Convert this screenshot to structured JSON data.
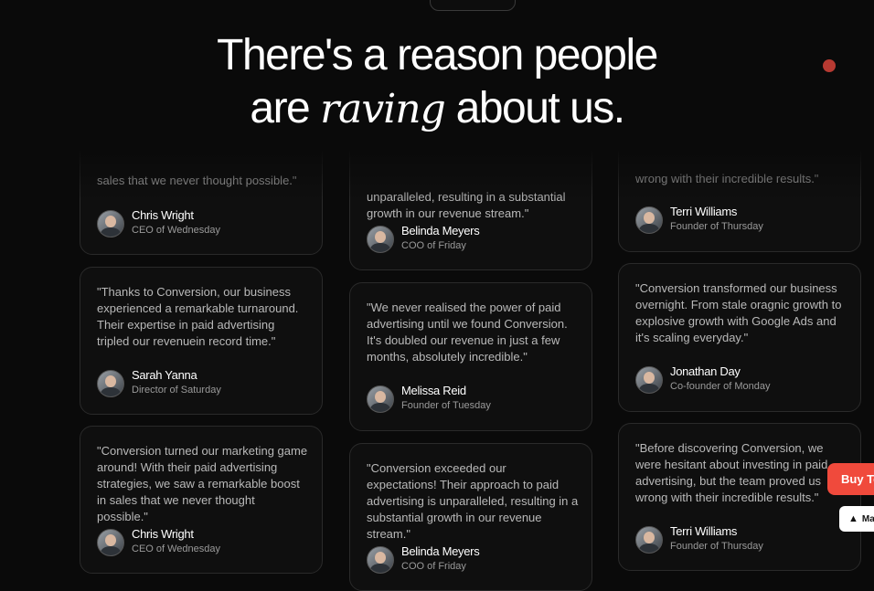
{
  "header": {
    "title_line1": "There's a reason people",
    "title_are": "are",
    "title_raving": "raving",
    "title_rest": "about us."
  },
  "columns": [
    {
      "cards": [
        {
          "quote": "sales that we never thought possible.\"",
          "name": "Chris Wright",
          "role": "CEO of Wednesday"
        },
        {
          "quote": "\"Thanks to Conversion, our business experienced a remarkable turnaround. Their expertise in paid advertising tripled our revenuein record time.\"",
          "name": "Sarah Yanna",
          "role": "Director of Saturday"
        },
        {
          "quote": "\"Conversion turned our marketing game around! With their paid advertising strategies, we saw a remarkable boost in sales that we never thought possible.\"",
          "name": "Chris Wright",
          "role": "CEO of Wednesday"
        }
      ]
    },
    {
      "cards": [
        {
          "quote": "unparalleled, resulting in a substantial growth in our revenue stream.\"",
          "name": "Belinda Meyers",
          "role": "COO of Friday"
        },
        {
          "quote": "\"We never realised the power of paid advertising until we found Conversion. It's doubled our revenue in just a few months, absolutely incredible.\"",
          "name": "Melissa Reid",
          "role": "Founder of Tuesday"
        },
        {
          "quote": "\"Conversion exceeded our expectations! Their approach to paid advertising is unparalleled, resulting in a substantial growth in our revenue stream.\"",
          "name": "Belinda Meyers",
          "role": "COO of Friday"
        }
      ]
    },
    {
      "cards": [
        {
          "quote": "wrong with their incredible results.\"",
          "name": "Terri Williams",
          "role": "Founder of Thursday"
        },
        {
          "quote": "\"Conversion transformed our business overnight. From stale oragnic growth to explosive growth with Google Ads and it's scaling everyday.\"",
          "name": "Jonathan Day",
          "role": "Co-founder of Monday"
        },
        {
          "quote": "\"Before discovering Conversion, we were hesitant about investing in paid advertising, but the team proved us wrong with their incredible results.\"",
          "name": "Terri Williams",
          "role": "Founder of Thursday"
        }
      ]
    }
  ],
  "cta": {
    "buy_label": "Buy Te",
    "made_label": "Ma",
    "logo_icon": "framer-logo-icon"
  },
  "colors": {
    "background": "#0a0a0a",
    "accent": "#f04a3c",
    "dot": "#b73a32"
  }
}
